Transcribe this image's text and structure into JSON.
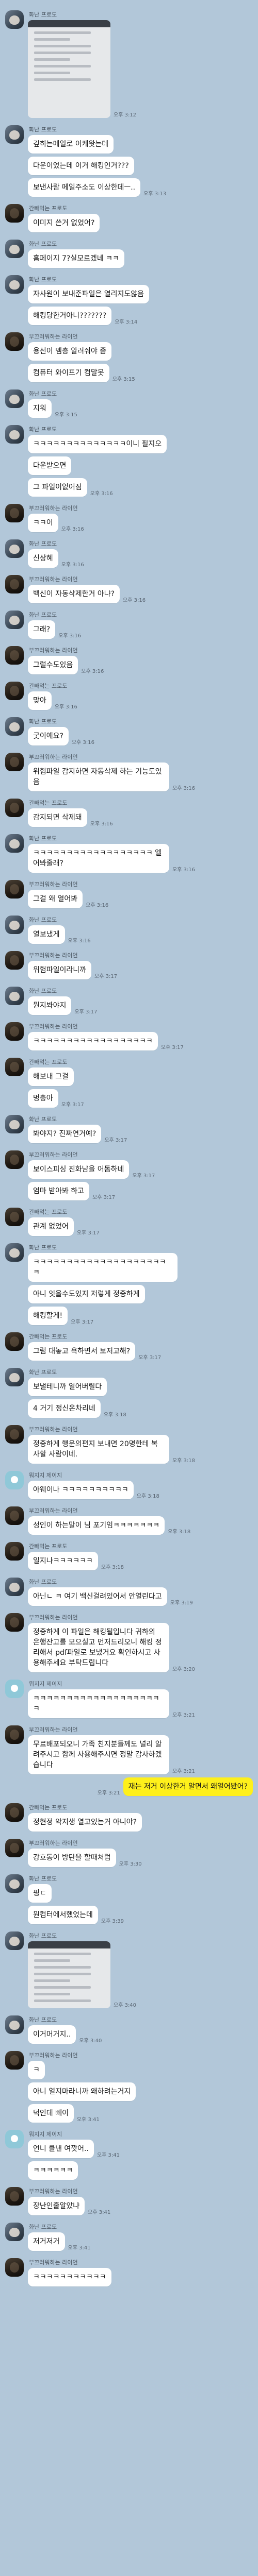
{
  "senders": {
    "hwasin": "화난 프로도",
    "bugyo": "부끄러워하는 라이언",
    "gan": "간빼먹는 프로도",
    "jigi": "뭐지지 제이지"
  },
  "messages": [
    {
      "id": 1,
      "side": "left",
      "sender": "화난 프로도",
      "avatar": "mask",
      "photo": true,
      "time": "오후 3:12"
    },
    {
      "id": 2,
      "side": "left",
      "sender": "화난 프로도",
      "avatar": "mask",
      "text": "깊히는메일로 이케왓는데",
      "time": ""
    },
    {
      "id": 3,
      "side": "left",
      "sender": "",
      "avatar": "blank",
      "text": "다운이었는데 이거 해킹인거???",
      "time": ""
    },
    {
      "id": 4,
      "side": "left",
      "sender": "",
      "avatar": "blank",
      "text": "보낸사람 메일주소도 이상한데ㅡ..",
      "time": "오후 3:13"
    },
    {
      "id": 5,
      "side": "left",
      "sender": "간빼먹는 프로도",
      "avatar": "dark",
      "text": "이미지 쓴거 없었어?",
      "time": ""
    },
    {
      "id": 6,
      "side": "left",
      "sender": "화난 프로도",
      "avatar": "mask",
      "text": "홈페이지 7?실모르겠네 ㅋㅋ",
      "time": ""
    },
    {
      "id": 7,
      "side": "left",
      "sender": "화난 프로도",
      "avatar": "mask",
      "text": "자사원이 보내준파일은 열리지도않음",
      "time": ""
    },
    {
      "id": 8,
      "side": "left",
      "sender": "",
      "avatar": "blank",
      "text": "해킹당한거아니???????",
      "time": "오후 3:14"
    },
    {
      "id": 9,
      "side": "left",
      "sender": "부끄러워하는 라이언",
      "avatar": "dark",
      "text": "용선이 멤층 알려줘야 좀",
      "time": ""
    },
    {
      "id": 10,
      "side": "left",
      "sender": "",
      "avatar": "blank",
      "text": "컴퓨터 와이프기 컴말못",
      "time": "오후 3:15"
    },
    {
      "id": 11,
      "side": "left",
      "sender": "화난 프로도",
      "avatar": "mask",
      "text": "지워",
      "time": "오후 3:15"
    },
    {
      "id": 12,
      "side": "left",
      "sender": "화난 프로도",
      "avatar": "mask",
      "text": "ㅋㅋㅋㅋㅋㅋㅋㅋㅋㅋㅋㅋㅋㅋ이니 필지오",
      "time": ""
    },
    {
      "id": 13,
      "side": "left",
      "sender": "",
      "avatar": "blank",
      "text": "다운받으면",
      "time": ""
    },
    {
      "id": 14,
      "side": "left",
      "sender": "",
      "avatar": "blank",
      "text": "그 파일이없어짐",
      "time": "오후 3:16"
    },
    {
      "id": 15,
      "side": "left",
      "sender": "부끄러워하는 라이언",
      "avatar": "dark",
      "text": "ㅋㅋ이",
      "time": "오후 3:16"
    },
    {
      "id": 16,
      "side": "left",
      "sender": "화난 프로도",
      "avatar": "mask",
      "text": "신상혜",
      "time": "오후 3:16"
    },
    {
      "id": 17,
      "side": "left",
      "sender": "부끄러워하는 라이언",
      "avatar": "dark",
      "text": "백신이 자동삭제한거 아냐?",
      "time": "오후 3:16"
    },
    {
      "id": 18,
      "side": "left",
      "sender": "화난 프로도",
      "avatar": "mask",
      "text": "그래?",
      "time": "오후 3:16"
    },
    {
      "id": 19,
      "side": "left",
      "sender": "부끄러워하는 라이언",
      "avatar": "dark",
      "text": "그럴수도있음",
      "time": "오후 3:16"
    },
    {
      "id": 20,
      "side": "left",
      "sender": "간빼먹는 프로도",
      "avatar": "dark",
      "text": "맞아",
      "time": "오후 3:16"
    },
    {
      "id": 21,
      "side": "left",
      "sender": "화난 프로도",
      "avatar": "mask",
      "text": "굿이예요?",
      "time": "오후 3:16"
    },
    {
      "id": 22,
      "side": "left",
      "sender": "부끄러워하는 라이언",
      "avatar": "dark",
      "text": "위험파일 감지하면 자동삭제 하는 기능도있음",
      "time": "오후 3:16"
    },
    {
      "id": 23,
      "side": "left",
      "sender": "간빼먹는 프로도",
      "avatar": "dark",
      "text": "감지되면 삭제돼",
      "time": "오후 3:16"
    },
    {
      "id": 24,
      "side": "left",
      "sender": "화난 프로도",
      "avatar": "mask",
      "text": "ㅋㅋㅋㅋㅋㅋㅋㅋㅋㅋㅋㅋㅋㅋㅋㅋㅋㅋ 엘어봐줄래?",
      "time": "오후 3:16"
    },
    {
      "id": 25,
      "side": "left",
      "sender": "부끄러워하는 라이언",
      "avatar": "dark",
      "text": "그걸 왜 열어봐",
      "time": "오후 3:16"
    },
    {
      "id": 26,
      "side": "left",
      "sender": "화난 프로도",
      "avatar": "mask",
      "text": "열보냈게",
      "time": "오후 3:16"
    },
    {
      "id": 27,
      "side": "left",
      "sender": "부끄러워하는 라이언",
      "avatar": "dark",
      "text": "위험파일이라니까",
      "time": "오후 3:17"
    },
    {
      "id": 28,
      "side": "left",
      "sender": "화난 프로도",
      "avatar": "mask",
      "text": "뭔지봐야지",
      "time": "오후 3:17"
    },
    {
      "id": 29,
      "side": "left",
      "sender": "부끄러워하는 라이언",
      "avatar": "dark",
      "text": "ㅋㅋㅋㅋㅋㅋㅋㅋㅋㅋㅋㅋㅋㅋㅋㅋㅋㅋ",
      "time": "오후 3:17"
    },
    {
      "id": 30,
      "side": "left",
      "sender": "간빼먹는 프로도",
      "avatar": "dark",
      "text": "해보내 그걸",
      "time": ""
    },
    {
      "id": 31,
      "side": "left",
      "sender": "",
      "avatar": "blank",
      "text": "멍층아",
      "time": "오후 3:17"
    },
    {
      "id": 32,
      "side": "left",
      "sender": "화난 프로도",
      "avatar": "mask",
      "text": "봐야지? 진짜연거예?",
      "time": "오후 3:17"
    },
    {
      "id": 33,
      "side": "left",
      "sender": "부끄러워하는 라이언",
      "avatar": "dark",
      "text": "보이스피싱 진화냠을 어돔하네",
      "time": "오후 3:17"
    },
    {
      "id": 34,
      "side": "left",
      "sender": "",
      "avatar": "blank",
      "text": "엄마 받아봐 하고",
      "time": "오후 3:17"
    },
    {
      "id": 35,
      "side": "left",
      "sender": "간빼먹는 프로도",
      "avatar": "dark",
      "text": "관계 없었어",
      "time": "오후 3:17"
    },
    {
      "id": 36,
      "side": "left",
      "sender": "화난 프로도",
      "avatar": "mask",
      "text": "ㅋㅋㅋㅋㅋㅋㅋㅋㅋㅋㅋㅋㅋㅋㅋㅋㅋㅋㅋㅋㅋ",
      "time": ""
    },
    {
      "id": 37,
      "side": "left",
      "sender": "",
      "avatar": "blank",
      "text": "아니 잇을수도있지 저렇게 정중하게",
      "time": ""
    },
    {
      "id": 38,
      "side": "left",
      "sender": "",
      "avatar": "blank",
      "text": "해킹할게!",
      "time": "오후 3:17"
    },
    {
      "id": 39,
      "side": "left",
      "sender": "간빼먹는 프로도",
      "avatar": "dark",
      "text": "그럼 대놓고 욕하면서 보저고해?",
      "time": "오후 3:17"
    },
    {
      "id": 40,
      "side": "left",
      "sender": "화난 프로도",
      "avatar": "mask",
      "text": "보낼테니까 열어버릴다",
      "time": ""
    },
    {
      "id": 41,
      "side": "left",
      "sender": "",
      "avatar": "blank",
      "text": "4 거기 정신온차리네",
      "time": "오후 3:18"
    },
    {
      "id": 42,
      "side": "left",
      "sender": "부끄러워하는 라이언",
      "avatar": "dark",
      "text": "정중하게 행운의편지 보내면 20명한테 복사할 사람이네.",
      "time": "오후 3:18"
    },
    {
      "id": 43,
      "side": "left",
      "sender": "뭐지지 제이지",
      "avatar": "teal",
      "text": "아웨이나 ㅋㅋㅋㅋㅋㅋㅋㅋㅋㅋ",
      "time": "오후 3:18"
    },
    {
      "id": 44,
      "side": "left",
      "sender": "부끄러워하는 라이언",
      "avatar": "dark",
      "text": "성인이 하는말이 님 포기임ㅋㅋㅋㅋㅋㅋㅋ",
      "time": "오후 3:18"
    },
    {
      "id": 45,
      "side": "left",
      "sender": "간빼먹는 프로도",
      "avatar": "dark",
      "text": "일지나ㅋㅋㅋㅋㅋㅋ",
      "time": "오후 3:18"
    },
    {
      "id": 46,
      "side": "left",
      "sender": "화난 프로도",
      "avatar": "mask",
      "text": "아닌ㄴ ㅋ 여기 백신걸려있어서 안열린다고",
      "time": "오후 3:19"
    },
    {
      "id": 47,
      "side": "left",
      "sender": "부끄러워하는 라이언",
      "avatar": "dark",
      "text": "정중하게 이 파일은 해킹될입니다 귀하의 은행잔고를 모으실고 먼저드리오니 해킹 정리해서 pdf파일로 보냈거요 확인하시고 사용해주세요 부탁드립니다",
      "time": "오후 3:20"
    },
    {
      "id": 48,
      "side": "left",
      "sender": "뭐지지 제이지",
      "avatar": "teal",
      "text": "ㅋㅋㅋㅋㅋㅋㅋㅋㅋㅋㅋㅋㅋㅋㅋㅋㅋㅋㅋㅋ",
      "time": "오후 3:21"
    },
    {
      "id": 49,
      "side": "left",
      "sender": "부끄러워하는 라이언",
      "avatar": "dark",
      "text": "무료배포되오니 가족 친지분들께도 널리 알려주시고 함께 사용해주시면 정말 감사하겠습니다",
      "time": "오후 3:21"
    },
    {
      "id": 50,
      "side": "right",
      "sender": "",
      "avatar": "",
      "text": "재는 저거 이상한거 알면서 왜열어봤어?",
      "time": "오후 3:21"
    },
    {
      "id": 51,
      "side": "left",
      "sender": "간빼먹는 프로도",
      "avatar": "dark",
      "text": "정현정 악지생 열고있는거 아니야?",
      "time": ""
    },
    {
      "id": 52,
      "side": "left",
      "sender": "부끄러워하는 라이언",
      "avatar": "dark",
      "text": "강호동이 방탄을 할때처럼",
      "time": "오후 3:30"
    },
    {
      "id": 53,
      "side": "left",
      "sender": "화난 프로도",
      "avatar": "mask",
      "text": "핑ㄷ",
      "time": ""
    },
    {
      "id": 54,
      "side": "left",
      "sender": "",
      "avatar": "blank",
      "text": "뭔컴터에서했었는데",
      "time": "오후 3:39"
    },
    {
      "id": 55,
      "side": "left",
      "sender": "화난 프로도",
      "avatar": "mask",
      "photo": true,
      "small": true,
      "time": "오후 3:40"
    },
    {
      "id": 56,
      "side": "left",
      "sender": "화난 프로도",
      "avatar": "mask",
      "text": "이거머거지..",
      "time": "오후 3:40"
    },
    {
      "id": 57,
      "side": "left",
      "sender": "부끄러워하는 라이언",
      "avatar": "dark",
      "text": "ㅋ",
      "time": ""
    },
    {
      "id": 58,
      "side": "left",
      "sender": "",
      "avatar": "blank",
      "text": "아니 열지마라니까 왜하려는거지",
      "time": ""
    },
    {
      "id": 59,
      "side": "left",
      "sender": "",
      "avatar": "blank",
      "text": "덕인데 뻬이",
      "time": "오후 3:41"
    },
    {
      "id": 60,
      "side": "left",
      "sender": "뭐지지 제이지",
      "avatar": "teal",
      "text": "언니 클낸 여깟어..",
      "time": "오후 3:41"
    },
    {
      "id": 61,
      "side": "left",
      "sender": "",
      "avatar": "blank",
      "text": "ㅋㅋㅋㅋㅋㅋ",
      "time": ""
    },
    {
      "id": 62,
      "side": "left",
      "sender": "부끄러워하는 라이언",
      "avatar": "dark",
      "text": "장난인줄알았냐",
      "time": "오후 3:41"
    },
    {
      "id": 63,
      "side": "left",
      "sender": "화난 프로도",
      "avatar": "mask",
      "text": "저거저거",
      "time": "오후 3:41"
    },
    {
      "id": 64,
      "side": "left",
      "sender": "부끄러워하는 라이언",
      "avatar": "dark",
      "text": "ㅋㅋㅋㅋㅋㅋㅋㅋㅋㅋㅋ",
      "time": ""
    }
  ]
}
